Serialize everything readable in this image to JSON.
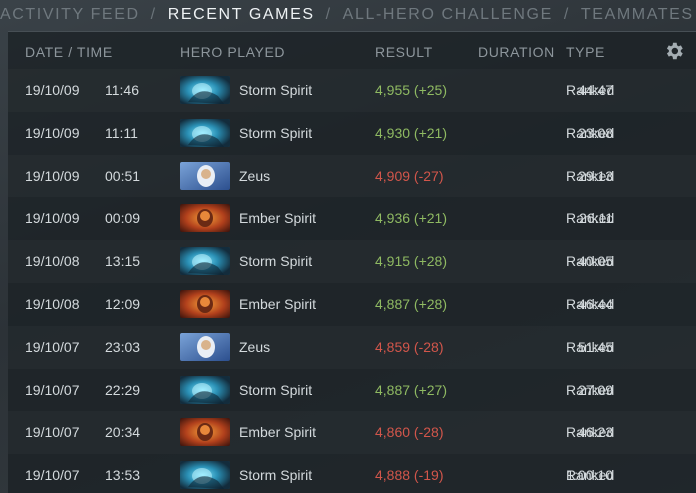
{
  "nav": {
    "tabs": [
      "Activity Feed",
      "Recent Games",
      "All-Hero Challenge",
      "Teammates"
    ],
    "separator": "/",
    "active": "Recent Games"
  },
  "table": {
    "headers": {
      "date_time": "DATE / TIME",
      "hero": "HERO PLAYED",
      "result": "RESULT",
      "duration": "DURATION",
      "type": "TYPE"
    },
    "settings_icon": "gear-icon",
    "rows": [
      {
        "date": "19/10/09",
        "time": "11:46",
        "hero": "Storm Spirit",
        "hero_icon": "storm-spirit-portrait-icon",
        "result": "4,955 (+25)",
        "outcome": "win",
        "duration": "44:47",
        "type": "Ranked"
      },
      {
        "date": "19/10/09",
        "time": "11:11",
        "hero": "Storm Spirit",
        "hero_icon": "storm-spirit-portrait-icon",
        "result": "4,930 (+21)",
        "outcome": "win",
        "duration": "23:08",
        "type": "Ranked"
      },
      {
        "date": "19/10/09",
        "time": "00:51",
        "hero": "Zeus",
        "hero_icon": "zeus-portrait-icon",
        "result": "4,909 (-27)",
        "outcome": "loss",
        "duration": "29:13",
        "type": "Ranked"
      },
      {
        "date": "19/10/09",
        "time": "00:09",
        "hero": "Ember Spirit",
        "hero_icon": "ember-spirit-portrait-icon",
        "result": "4,936 (+21)",
        "outcome": "win",
        "duration": "26:11",
        "type": "Ranked"
      },
      {
        "date": "19/10/08",
        "time": "13:15",
        "hero": "Storm Spirit",
        "hero_icon": "storm-spirit-portrait-icon",
        "result": "4,915 (+28)",
        "outcome": "win",
        "duration": "40:05",
        "type": "Ranked"
      },
      {
        "date": "19/10/08",
        "time": "12:09",
        "hero": "Ember Spirit",
        "hero_icon": "ember-spirit-portrait-icon",
        "result": "4,887 (+28)",
        "outcome": "win",
        "duration": "46:44",
        "type": "Ranked"
      },
      {
        "date": "19/10/07",
        "time": "23:03",
        "hero": "Zeus",
        "hero_icon": "zeus-portrait-icon",
        "result": "4,859 (-28)",
        "outcome": "loss",
        "duration": "51:45",
        "type": "Ranked"
      },
      {
        "date": "19/10/07",
        "time": "22:29",
        "hero": "Storm Spirit",
        "hero_icon": "storm-spirit-portrait-icon",
        "result": "4,887 (+27)",
        "outcome": "win",
        "duration": "27:09",
        "type": "Ranked"
      },
      {
        "date": "19/10/07",
        "time": "20:34",
        "hero": "Ember Spirit",
        "hero_icon": "ember-spirit-portrait-icon",
        "result": "4,860 (-28)",
        "outcome": "loss",
        "duration": "46:23",
        "type": "Ranked"
      },
      {
        "date": "19/10/07",
        "time": "13:53",
        "hero": "Storm Spirit",
        "hero_icon": "storm-spirit-portrait-icon",
        "result": "4,888 (-19)",
        "outcome": "loss",
        "duration": "1:00:10",
        "type": "Ranked"
      }
    ]
  },
  "colors": {
    "win": "#8fba62",
    "loss": "#d2564b",
    "active_tab": "#eef2f4",
    "inactive_tab": "#6f787e"
  }
}
